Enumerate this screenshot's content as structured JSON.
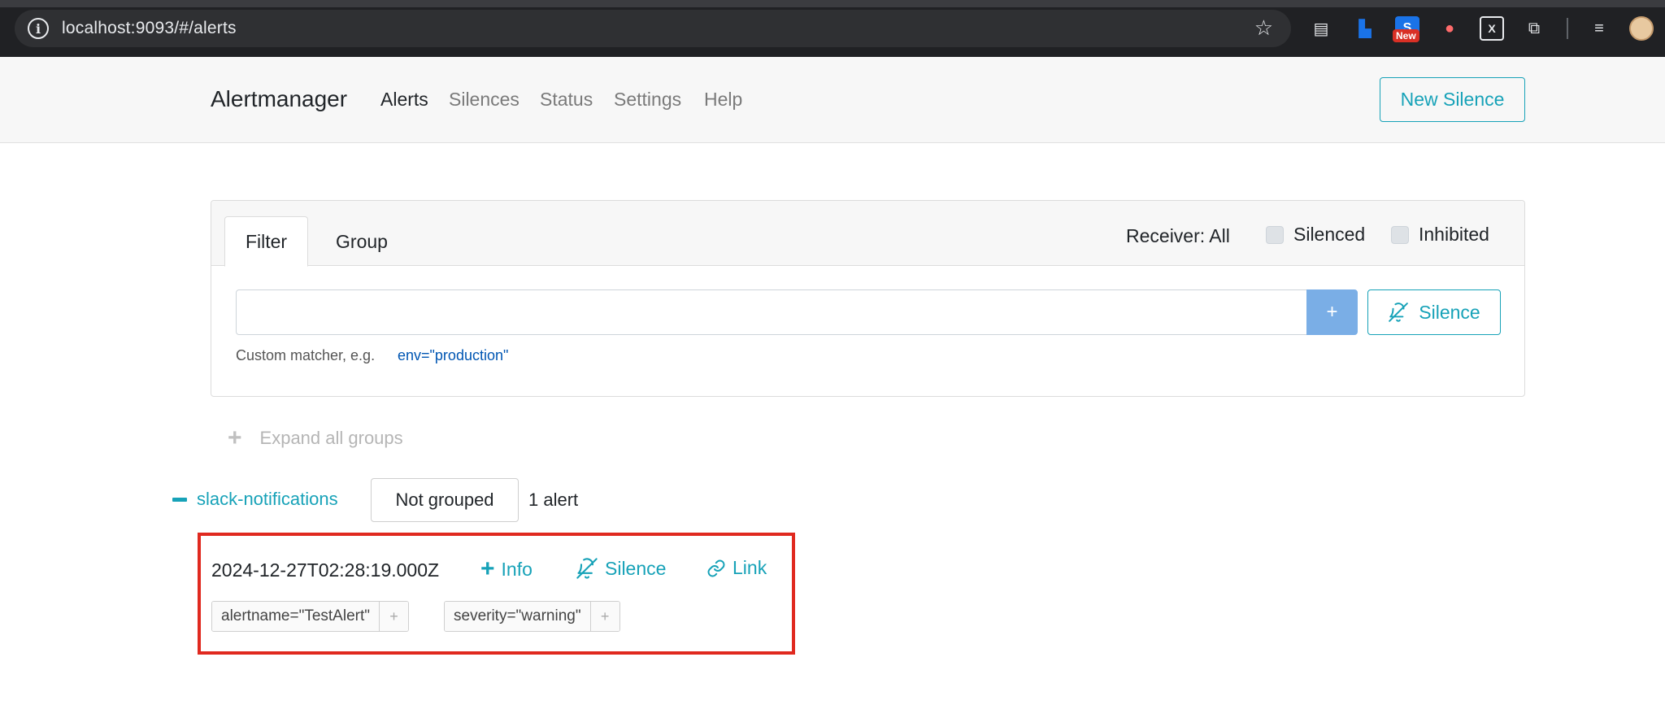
{
  "browser": {
    "url": "localhost:9093/#/alerts",
    "new_badge": "New"
  },
  "navbar": {
    "brand": "Alertmanager",
    "links": [
      "Alerts",
      "Silences",
      "Status",
      "Settings",
      "Help"
    ],
    "active": "Alerts",
    "new_silence_label": "New Silence"
  },
  "filter": {
    "tabs": [
      "Filter",
      "Group"
    ],
    "active_tab": "Filter",
    "receiver_label": "Receiver: All",
    "silenced_label": "Silenced",
    "silenced_checked": false,
    "inhibited_label": "Inhibited",
    "inhibited_checked": false,
    "input_value": "",
    "add_label": "+",
    "silence_label": "Silence",
    "helper_text": "Custom matcher, e.g.",
    "helper_example": "env=\"production\""
  },
  "expand_all_label": "Expand all groups",
  "group": {
    "name": "slack-notifications",
    "grouping": "Not grouped",
    "count_label": "1 alert"
  },
  "alert": {
    "timestamp": "2024-12-27T02:28:19.000Z",
    "info_label": "Info",
    "silence_label": "Silence",
    "link_label": "Link",
    "labels": [
      "alertname=\"TestAlert\"",
      "severity=\"warning\""
    ],
    "highlight_color": "#e0291f"
  },
  "colors": {
    "accent": "#17a2b8",
    "add_button": "#7aaee6"
  },
  "icons": {
    "info": "info-icon",
    "star": "bookmark-star-icon",
    "bell_off": "bell-slash-icon",
    "link": "link-icon",
    "plus": "plus-icon",
    "minus": "minus-icon"
  }
}
